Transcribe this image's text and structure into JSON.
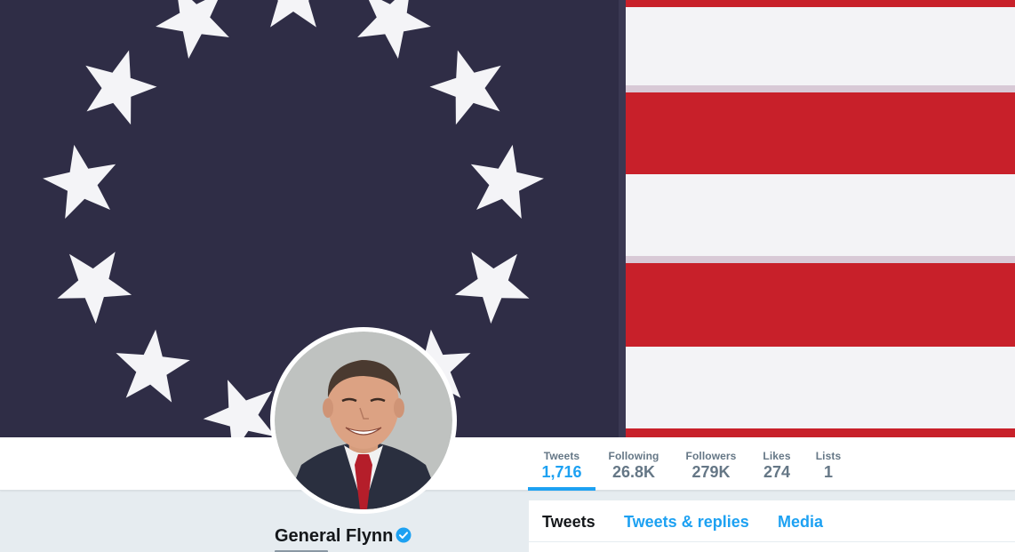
{
  "profile": {
    "name": "General Flynn",
    "verified": true
  },
  "stats": [
    {
      "label": "Tweets",
      "value": "1,716",
      "active": true
    },
    {
      "label": "Following",
      "value": "26.8K",
      "active": false
    },
    {
      "label": "Followers",
      "value": "279K",
      "active": false
    },
    {
      "label": "Likes",
      "value": "274",
      "active": false
    },
    {
      "label": "Lists",
      "value": "1",
      "active": false
    }
  ],
  "timeline": {
    "tabs": [
      {
        "label": "Tweets",
        "active": true
      },
      {
        "label": "Tweets & replies",
        "active": false
      },
      {
        "label": "Media",
        "active": false
      }
    ]
  },
  "colors": {
    "accent": "#1da1f2",
    "flag_blue": "#2f2d46",
    "flag_red": "#c8202a",
    "flag_white": "#f3f3f6"
  },
  "icons": {
    "verified": "verified-badge-icon"
  }
}
